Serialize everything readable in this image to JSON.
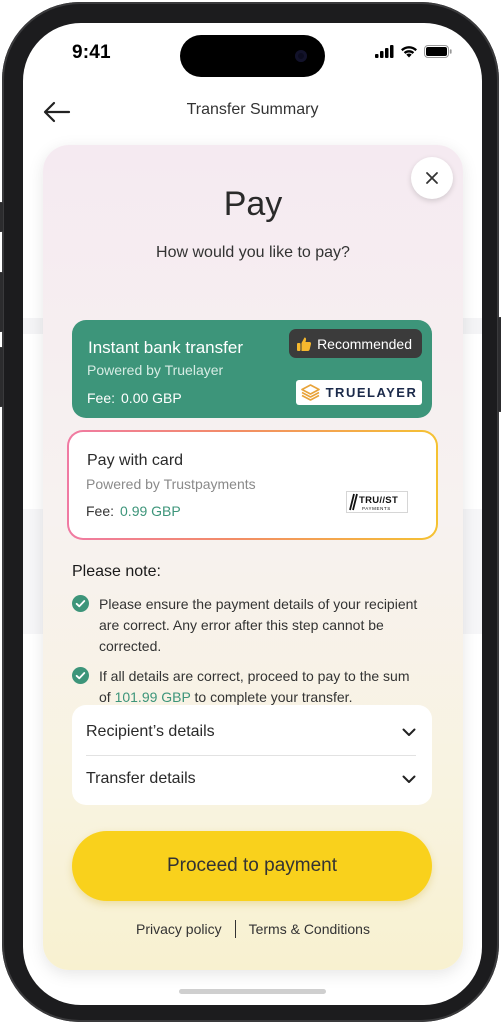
{
  "status_bar": {
    "time": "9:41",
    "icons": [
      "cellular-signal-icon",
      "wifi-icon",
      "battery-icon"
    ]
  },
  "nav": {
    "back_icon": "arrow-left-icon",
    "title": "Transfer Summary"
  },
  "sheet": {
    "close_icon": "close-icon",
    "title": "Pay",
    "subtitle": "How would you like to pay?",
    "options": [
      {
        "name": "Instant bank transfer",
        "powered_by": "Powered by Truelayer",
        "fee_label": "Fee:",
        "fee_value": "0.00 GBP",
        "badge": "Recommended",
        "badge_icon": "thumbs-up-icon",
        "logo_text": "TRUELAYER",
        "selected": true,
        "color": "#3d957a"
      },
      {
        "name": "Pay with card",
        "powered_by": "Powered by Trustpayments",
        "fee_label": "Fee:",
        "fee_value": "0.99 GBP",
        "logo_text": "TRU//ST",
        "logo_subtext": "PAYMENTS",
        "selected": false
      }
    ],
    "note": {
      "title": "Please note:",
      "items": [
        "Please ensure the payment details of your recipient are correct. Any error after this step cannot be corrected.",
        {
          "before": "If all details are correct, proceed to pay to the sum of ",
          "amount": "101.99 GBP",
          "after": " to complete your transfer."
        }
      ]
    },
    "details": [
      {
        "label": "Recipient’s details",
        "icon": "chevron-down-icon"
      },
      {
        "label": "Transfer details",
        "icon": "chevron-down-icon"
      }
    ],
    "proceed_label": "Proceed to payment",
    "footer": {
      "privacy": "Privacy policy",
      "terms": "Terms & Conditions"
    }
  },
  "colors": {
    "accent_green": "#3d957a",
    "button_yellow": "#f9d11c",
    "badge_dark": "#3b3b3b"
  }
}
